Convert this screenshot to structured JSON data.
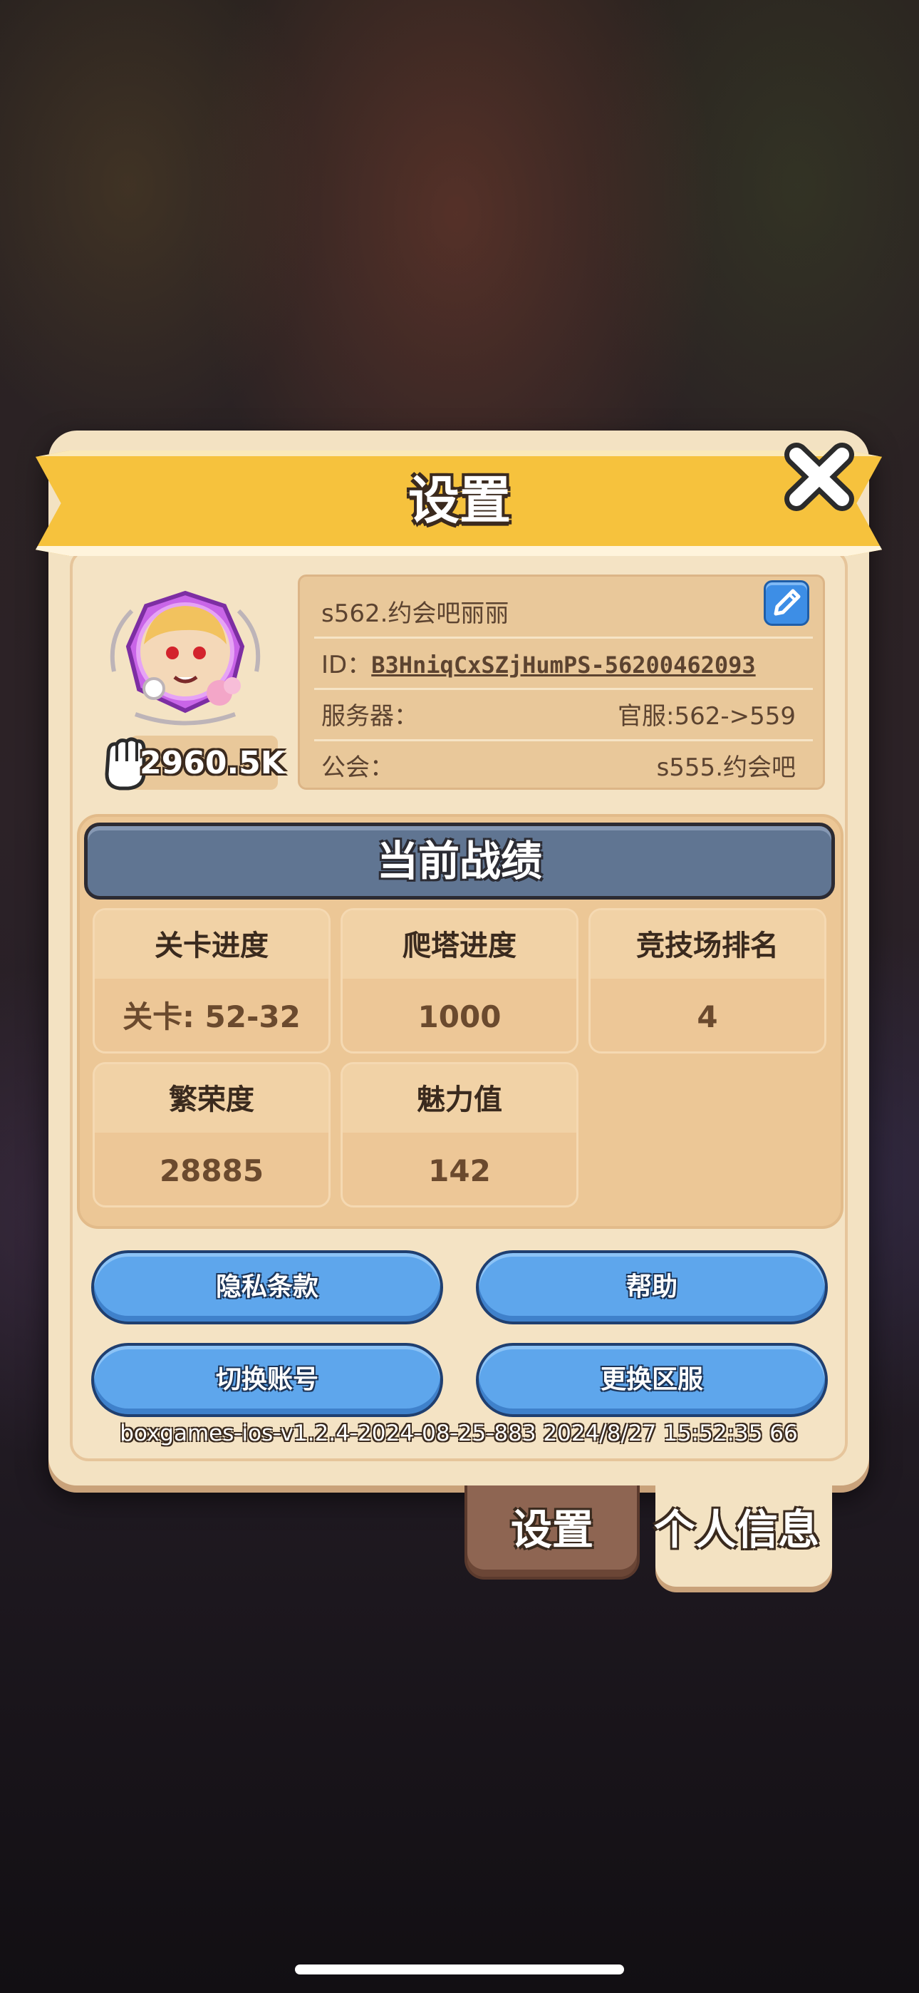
{
  "title": "设置",
  "player": {
    "name": "s562.约会吧丽丽",
    "id_label": "ID：",
    "id_value": "B3HniqCxSZjHumPS-56200462093",
    "server_label": "服务器：",
    "server_value": "官服:562->559",
    "guild_label": "公会：",
    "guild_value": "s555.约会吧",
    "power": "2960.5K"
  },
  "stats": {
    "title": "当前战绩",
    "items": [
      {
        "label": "关卡进度",
        "value": "关卡: 52-32"
      },
      {
        "label": "爬塔进度",
        "value": "1000"
      },
      {
        "label": "竞技场排名",
        "value": "4"
      },
      {
        "label": "繁荣度",
        "value": "28885"
      },
      {
        "label": "魅力值",
        "value": "142"
      }
    ]
  },
  "buttons": {
    "privacy": "隐私条款",
    "help": "帮助",
    "switch_account": "切换账号",
    "change_server": "更换区服"
  },
  "version": "boxgames-ios-v1.2.4-2024-08-25-883 2024/8/27 15:52:35 66",
  "tabs": {
    "settings": "设置",
    "profile": "个人信息"
  },
  "icons": {
    "close": "close-icon",
    "edit": "pencil-icon",
    "power": "fist-icon",
    "avatar": "avatar-portrait"
  },
  "colors": {
    "banner": "#f6c23d",
    "panel": "#f3e2c2",
    "button_blue": "#5ea6ec",
    "stats_header": "#607592",
    "tab_active": "#8e6552"
  }
}
